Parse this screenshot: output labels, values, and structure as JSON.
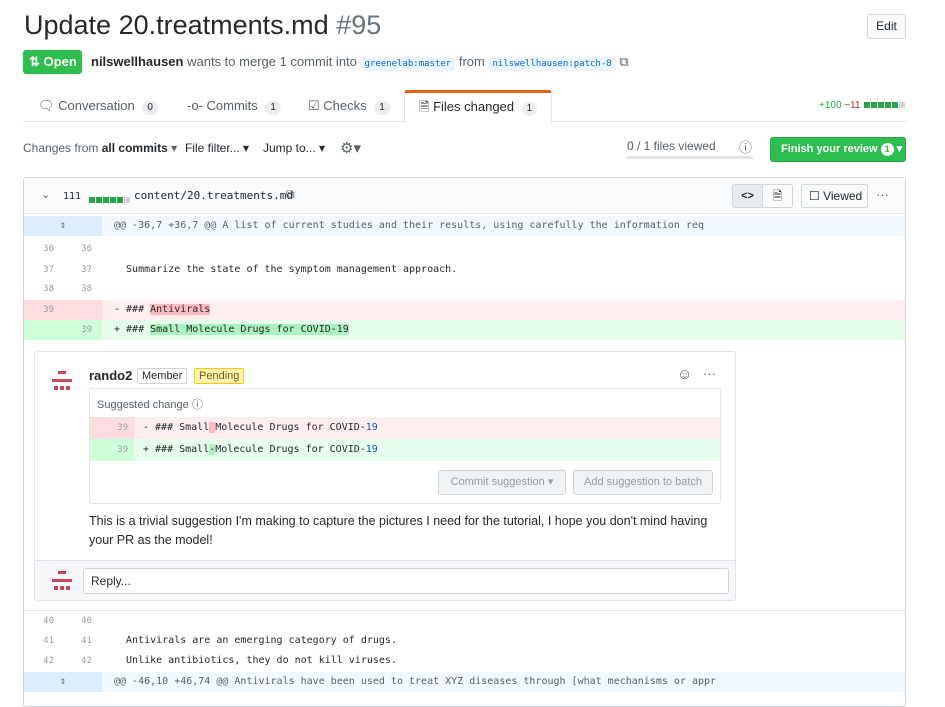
{
  "pr": {
    "title": "Update 20.treatments.md",
    "number": "#95",
    "edit_label": "Edit",
    "state": "Open",
    "author": "nilswellhausen",
    "merge_text": "wants to merge 1 commit into",
    "base_branch": "greenelab:master",
    "from_text": "from",
    "head_branch": "nilswellhausen:patch-8"
  },
  "tabs": [
    {
      "label": "Conversation",
      "count": "0"
    },
    {
      "label": "Commits",
      "count": "1"
    },
    {
      "label": "Checks",
      "count": "1"
    },
    {
      "label": "Files changed",
      "count": "1"
    }
  ],
  "diffstat": {
    "additions": "+100",
    "deletions": "−11"
  },
  "toolbar": {
    "changes_prefix": "Changes from",
    "changes_value": "all commits",
    "file_filter": "File filter...",
    "jump_to": "Jump to...",
    "files_viewed": "0 / 1 files viewed",
    "finish_review": "Finish your review",
    "finish_count": "1"
  },
  "file": {
    "changes": "111",
    "path": "content/20.treatments.md",
    "viewed_label": "Viewed"
  },
  "diff": {
    "hunk1": "@@ -36,7 +36,7 @@ A list of current studies and their results, using carefully the information req",
    "rows": [
      {
        "old": "36",
        "new": "36",
        "text": ""
      },
      {
        "old": "37",
        "new": "37",
        "text": "  Summarize the state of the symptom management approach."
      },
      {
        "old": "38",
        "new": "38",
        "text": ""
      }
    ],
    "del": {
      "old": "39",
      "prefix": "- ### ",
      "hl": "Antivirals"
    },
    "add": {
      "new": "39",
      "prefix": "+ ### ",
      "hl": "Small Molecule Drugs for COVID-19"
    },
    "rows2": [
      {
        "old": "40",
        "new": "40",
        "text": ""
      },
      {
        "old": "41",
        "new": "41",
        "text": "  Antivirals are an emerging category of drugs."
      },
      {
        "old": "42",
        "new": "42",
        "text": "  Unlike antibiotics, they do not kill viruses."
      }
    ],
    "hunk2": "@@ -46,10 +46,74 @@ Antivirals have been used to treat XYZ diseases through [what mechanisms or appr"
  },
  "comment": {
    "author": "rando2",
    "role": "Member",
    "status": "Pending",
    "suggested_label": "Suggested change",
    "sug_del_ln": "39",
    "sug_del_a": "- ### Small",
    "sug_del_b": "Molecule Drugs for COVID-",
    "sug_del_c": "19",
    "sug_add_ln": "39",
    "sug_add_a": "+ ### Small",
    "sug_add_hl": "-",
    "sug_add_b": "Molecule Drugs for COVID-",
    "sug_add_c": "19",
    "commit_btn": "Commit suggestion",
    "batch_btn": "Add suggestion to batch",
    "body_line1": "This is a trivial suggestion I'm making to capture the pictures I need for the tutorial, I hope you don't mind having",
    "body_line2": "your PR as the model!",
    "reply_placeholder": "Reply..."
  }
}
